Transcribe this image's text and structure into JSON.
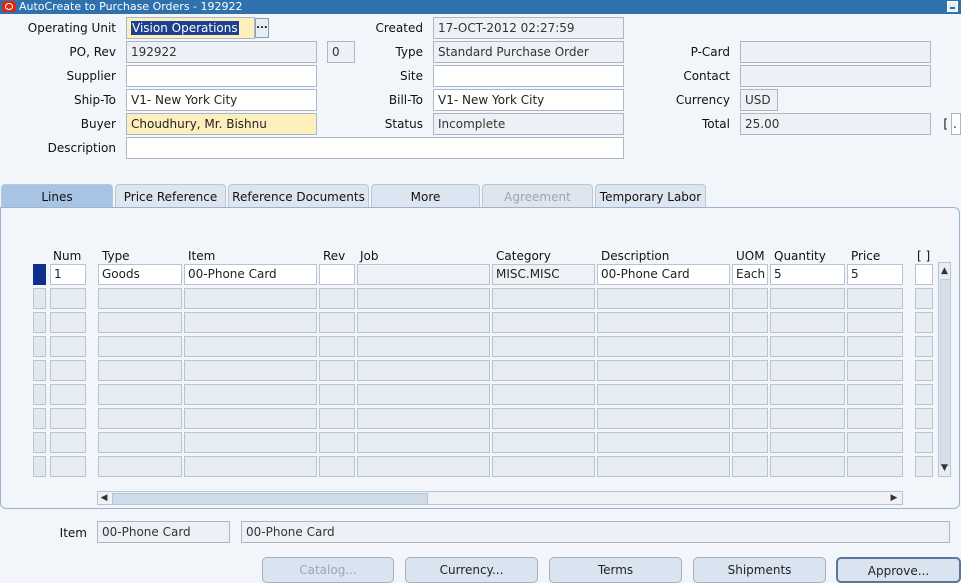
{
  "window": {
    "title": "AutoCreate to Purchase Orders - 192922"
  },
  "header": {
    "operating_unit_label": "Operating Unit",
    "operating_unit_value": "Vision Operations",
    "lov_button_label": "...",
    "po_rev_label": "PO, Rev",
    "po_value": "192922",
    "rev_value": "0",
    "supplier_label": "Supplier",
    "supplier_value": "",
    "shipto_label": "Ship-To",
    "shipto_value": "V1- New York City",
    "buyer_label": "Buyer",
    "buyer_value": "Choudhury, Mr. Bishnu",
    "description_label": "Description",
    "description_value": "",
    "created_label": "Created",
    "created_value": "17-OCT-2012 02:27:59",
    "type_label": "Type",
    "type_value": "Standard Purchase Order",
    "site_label": "Site",
    "site_value": "",
    "billto_label": "Bill-To",
    "billto_value": "V1- New York City",
    "status_label": "Status",
    "status_value": "Incomplete",
    "pcard_label": "P-Card",
    "pcard_value": "",
    "contact_label": "Contact",
    "contact_value": "",
    "currency_label": "Currency",
    "currency_value": "USD",
    "total_label": "Total",
    "total_value": "25.00",
    "extra_bracket": "[",
    "extra_field": "."
  },
  "tabs": [
    {
      "label": "Lines"
    },
    {
      "label": "Price Reference"
    },
    {
      "label": "Reference Documents"
    },
    {
      "label": "More"
    },
    {
      "label": "Agreement"
    },
    {
      "label": "Temporary Labor"
    }
  ],
  "table": {
    "columns": [
      "Num",
      "Type",
      "Item",
      "Rev",
      "Job",
      "Category",
      "Description",
      "UOM",
      "Quantity",
      "Price",
      "[ ]"
    ],
    "rows": [
      {
        "num": "1",
        "type": "Goods",
        "item": "00-Phone Card",
        "rev": "",
        "job": "",
        "category": "MISC.MISC",
        "description": "00-Phone Card",
        "uom": "Each",
        "quantity": "5",
        "price": "5"
      }
    ]
  },
  "footer": {
    "item_label": "Item",
    "item_value": "00-Phone Card",
    "item_description": "00-Phone Card"
  },
  "buttons": [
    {
      "label": "Catalog..."
    },
    {
      "label": "Currency..."
    },
    {
      "label": "Terms"
    },
    {
      "label": "Shipments"
    },
    {
      "label": "Approve..."
    }
  ]
}
